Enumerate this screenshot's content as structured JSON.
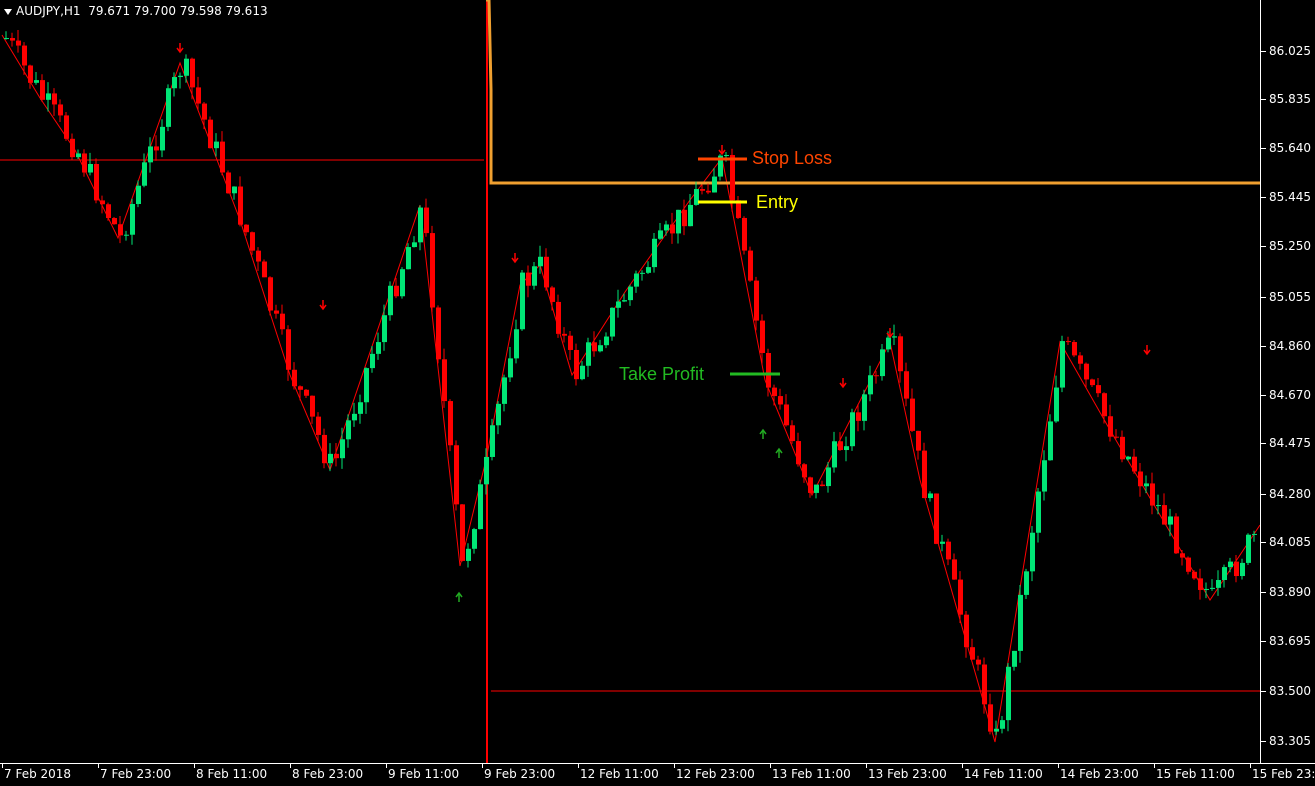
{
  "header": {
    "symbol": "AUDJPY,H1",
    "ohlc": "79.671 79.700 79.598 79.613"
  },
  "price_axis": {
    "labels": [
      "86.025",
      "85.835",
      "85.640",
      "85.445",
      "85.250",
      "85.055",
      "84.860",
      "84.670",
      "84.475",
      "84.280",
      "84.085",
      "83.890",
      "83.695",
      "83.500",
      "83.305"
    ]
  },
  "time_axis": {
    "labels": [
      "7 Feb 2018",
      "7 Feb 23:00",
      "8 Feb 11:00",
      "8 Feb 23:00",
      "9 Feb 11:00",
      "9 Feb 23:00",
      "12 Feb 11:00",
      "12 Feb 23:00",
      "13 Feb 11:00",
      "13 Feb 23:00",
      "14 Feb 11:00",
      "14 Feb 23:00",
      "15 Feb 11:00",
      "15 Feb 23:00"
    ]
  },
  "annotations": {
    "stop_loss": "Stop Loss",
    "entry": "Entry",
    "take_profit": "Take Profit"
  },
  "colors": {
    "bull_candle": "#00e676",
    "bear_candle": "#ff0000",
    "zigzag": "#ff0000",
    "orange_level": "#f0a030",
    "stop_loss": "#ff4500",
    "entry": "#ffff00",
    "take_profit": "#22bb22"
  },
  "icons": {
    "down_arrow": "red-down-arrow-icon",
    "up_arrow": "green-up-arrow-icon"
  }
}
